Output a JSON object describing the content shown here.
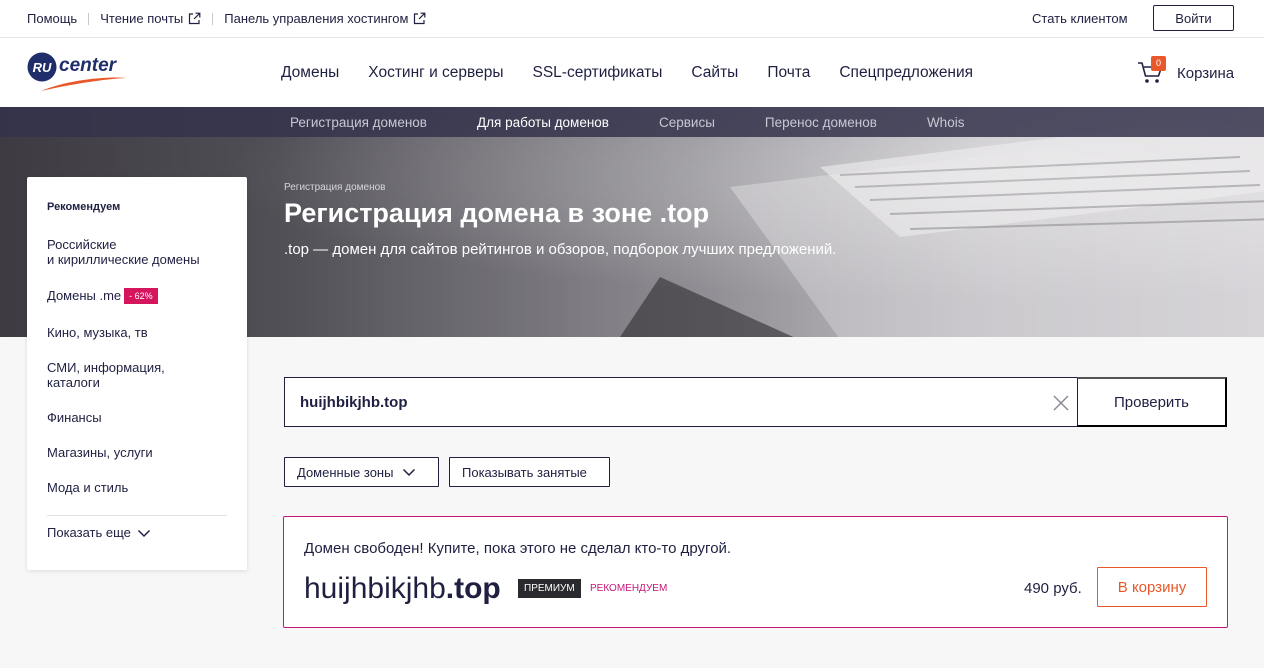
{
  "topbar": {
    "help": "Помощь",
    "mail": "Чтение почты",
    "hosting_panel": "Панель управления хостингом",
    "become_client": "Стать клиентом",
    "login": "Войти"
  },
  "logo": {
    "ru": "RU",
    "center": "center"
  },
  "nav": [
    "Домены",
    "Хостинг и серверы",
    "SSL-сертификаты",
    "Сайты",
    "Почта",
    "Спецпредложения"
  ],
  "cart": {
    "count": "0",
    "label": "Корзина"
  },
  "subnav": [
    "Регистрация доменов",
    "Для работы доменов",
    "Сервисы",
    "Перенос доменов",
    "Whois"
  ],
  "hero": {
    "breadcrumb": "Регистрация доменов",
    "title": "Регистрация домена в зоне .top",
    "description": ".top — домен для сайтов рейтингов и обзоров, подборок лучших предложений."
  },
  "sidebar": {
    "heading": "Рекомендуем",
    "items": [
      "Российские\nи кириллические домены",
      "Домены .me",
      "Кино, музыка, тв",
      "СМИ, информация,\nкаталоги",
      "Финансы",
      "Магазины, услуги",
      "Мода и стиль"
    ],
    "me_badge": "- 62%",
    "show_more": "Показать еще"
  },
  "search": {
    "value": "huijhbikjhb.top",
    "check_button": "Проверить"
  },
  "filters": {
    "zones": "Доменные зоны",
    "show_taken": "Показывать занятые"
  },
  "result": {
    "status": "Домен свободен! Купите, пока этого не сделал кто-то другой.",
    "name": "huijhbikjhb",
    "tld": ".top",
    "premium": "ПРЕМИУМ",
    "recommend": "РЕКОМЕНДУЕМ",
    "price": "490 руб.",
    "buy": "В корзину"
  },
  "colors": {
    "navy": "#1f2041",
    "accent_orange": "#e8582b",
    "magenta": "#c5177b",
    "badge_pink": "#d6155f"
  }
}
